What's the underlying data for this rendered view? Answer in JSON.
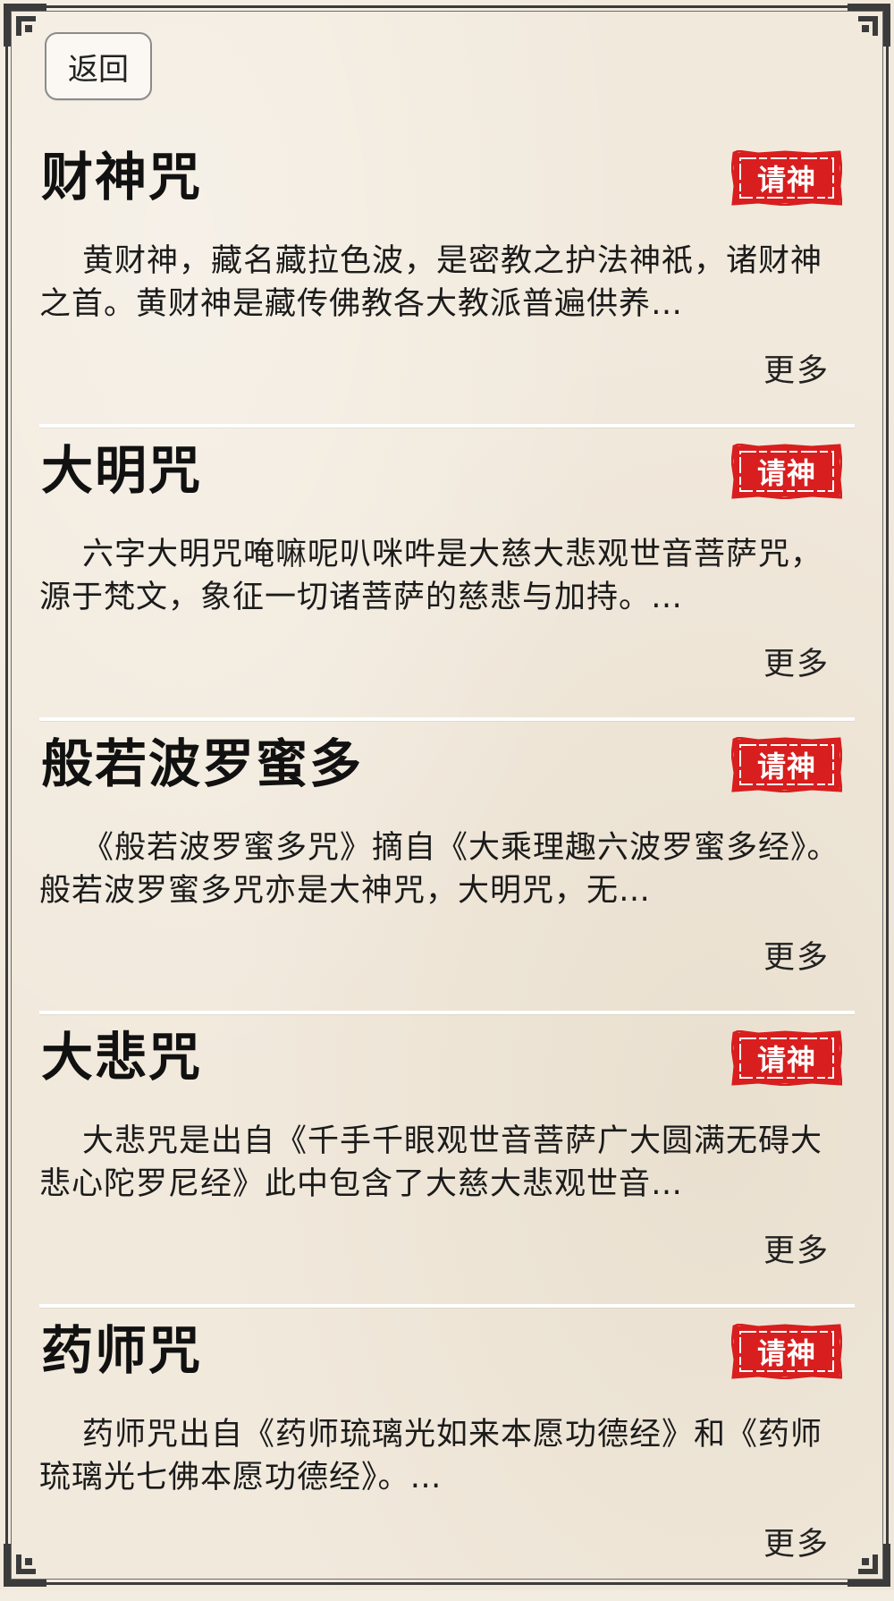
{
  "header": {
    "back_label": "返回"
  },
  "theme": {
    "seal_red": "#d81e1e",
    "frame_color": "#3b3b3b",
    "paper_color": "#f1e9dc"
  },
  "items": [
    {
      "title": "财神咒",
      "action_label": "请神",
      "description": "黄财神，藏名藏拉色波，是密教之护法神祇，诸财神之首。黄财神是藏传佛教各大教派普遍供养…",
      "more_label": "更多"
    },
    {
      "title": "大明咒",
      "action_label": "请神",
      "description": "六字大明咒唵嘛呢叭咪吽是大慈大悲观世音菩萨咒，源于梵文，象征一切诸菩萨的慈悲与加持。…",
      "more_label": "更多"
    },
    {
      "title": "般若波罗蜜多",
      "action_label": "请神",
      "description": "《般若波罗蜜多咒》摘自《大乘理趣六波罗蜜多经》。般若波罗蜜多咒亦是大神咒，大明咒，无…",
      "more_label": "更多"
    },
    {
      "title": "大悲咒",
      "action_label": "请神",
      "description": "大悲咒是出自《千手千眼观世音菩萨广大圆满无碍大悲心陀罗尼经》此中包含了大慈大悲观世音…",
      "more_label": "更多"
    },
    {
      "title": "药师咒",
      "action_label": "请神",
      "description": "药师咒出自《药师琉璃光如来本愿功德经》和《药师琉璃光七佛本愿功德经》。…",
      "more_label": "更多"
    }
  ]
}
